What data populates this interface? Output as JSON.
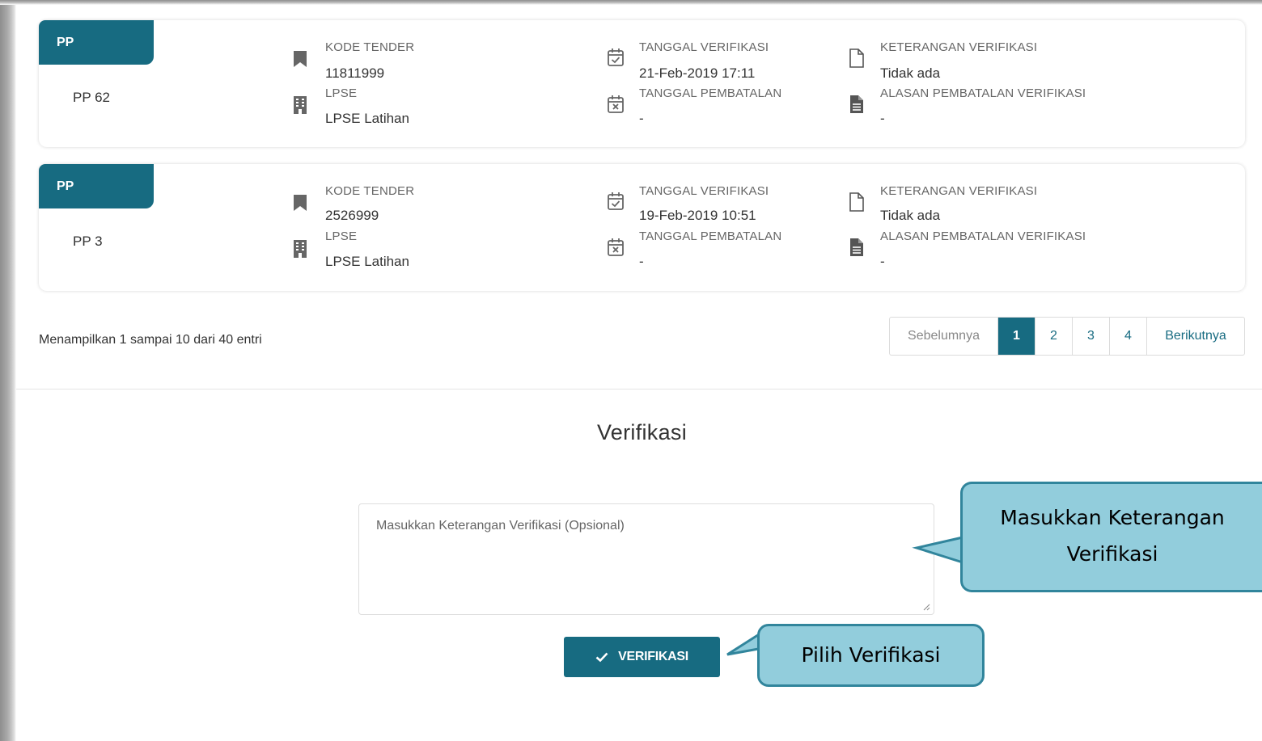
{
  "records": [
    {
      "badge": "PP",
      "pp_name": "PP 62",
      "kode_tender_label": "KODE TENDER",
      "kode_tender": "11811999",
      "lpse_label": "LPSE",
      "lpse": "LPSE Latihan",
      "tanggal_verifikasi_label": "TANGGAL VERIFIKASI",
      "tanggal_verifikasi": "21-Feb-2019 17:11",
      "tanggal_pembatalan_label": "TANGGAL PEMBATALAN",
      "tanggal_pembatalan": "-",
      "keterangan_label": "KETERANGAN VERIFIKASI",
      "keterangan": "Tidak ada",
      "alasan_label": "ALASAN PEMBATALAN VERIFIKASI",
      "alasan": "-"
    },
    {
      "badge": "PP",
      "pp_name": "PP 3",
      "kode_tender_label": "KODE TENDER",
      "kode_tender": "2526999",
      "lpse_label": "LPSE",
      "lpse": "LPSE Latihan",
      "tanggal_verifikasi_label": "TANGGAL VERIFIKASI",
      "tanggal_verifikasi": "19-Feb-2019 10:51",
      "tanggal_pembatalan_label": "TANGGAL PEMBATALAN",
      "tanggal_pembatalan": "-",
      "keterangan_label": "KETERANGAN VERIFIKASI",
      "keterangan": "Tidak ada",
      "alasan_label": "ALASAN PEMBATALAN VERIFIKASI",
      "alasan": "-"
    }
  ],
  "table_info": "Menampilkan 1 sampai 10 dari 40 entri",
  "pagination": {
    "prev": "Sebelumnya",
    "pages": [
      "1",
      "2",
      "3",
      "4"
    ],
    "active_page": "1",
    "next": "Berikutnya"
  },
  "verification": {
    "title": "Verifikasi",
    "textarea_placeholder": "Masukkan Keterangan Verifikasi (Opsional)",
    "button_label": "VERIFIKASI"
  },
  "callouts": {
    "keterangan": "Masukkan Keterangan Verifikasi",
    "pilih": "Pilih Verifikasi"
  },
  "icons": {
    "kode_tender": "bookmark-icon",
    "lpse": "building-icon",
    "tanggal_verifikasi": "calendar-check-icon",
    "tanggal_pembatalan": "calendar-x-icon",
    "keterangan": "document-outline-icon",
    "alasan": "document-filled-icon",
    "button": "checkmark-icon"
  },
  "colors": {
    "primary": "#176b81",
    "callout_fill": "#92cddc",
    "callout_border": "#31859c"
  }
}
